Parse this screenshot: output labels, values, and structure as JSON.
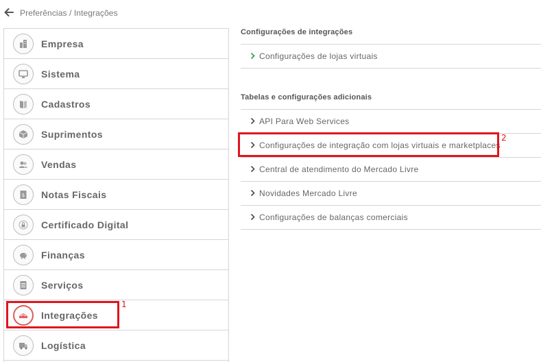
{
  "breadcrumb": "Preferências / Integrações",
  "sidebar": {
    "items": [
      {
        "label": "Empresa",
        "icon": "building-icon"
      },
      {
        "label": "Sistema",
        "icon": "monitor-icon"
      },
      {
        "label": "Cadastros",
        "icon": "book-icon"
      },
      {
        "label": "Suprimentos",
        "icon": "box-icon"
      },
      {
        "label": "Vendas",
        "icon": "users-icon"
      },
      {
        "label": "Notas Fiscais",
        "icon": "invoice-icon"
      },
      {
        "label": "Certificado Digital",
        "icon": "lock-icon"
      },
      {
        "label": "Finanças",
        "icon": "piggy-bank-icon"
      },
      {
        "label": "Serviços",
        "icon": "document-icon"
      },
      {
        "label": "Integrações",
        "icon": "integration-icon"
      },
      {
        "label": "Logística",
        "icon": "truck-icon"
      }
    ]
  },
  "main": {
    "section1": {
      "title": "Configurações de integrações",
      "items": [
        "Configurações de lojas virtuais"
      ]
    },
    "section2": {
      "title": "Tabelas e configurações adicionais",
      "items": [
        "API Para Web Services",
        "Configurações de integração com lojas virtuais e marketplaces",
        "Central de atendimento do Mercado Livre",
        "Novidades Mercado Livre",
        "Configurações de balanças comerciais"
      ]
    }
  },
  "annotations": {
    "marker1": "1",
    "marker2": "2"
  },
  "colors": {
    "highlight": "#e0141e",
    "active_icon": "#e05a5a",
    "chevron_green": "#3aa34a"
  }
}
